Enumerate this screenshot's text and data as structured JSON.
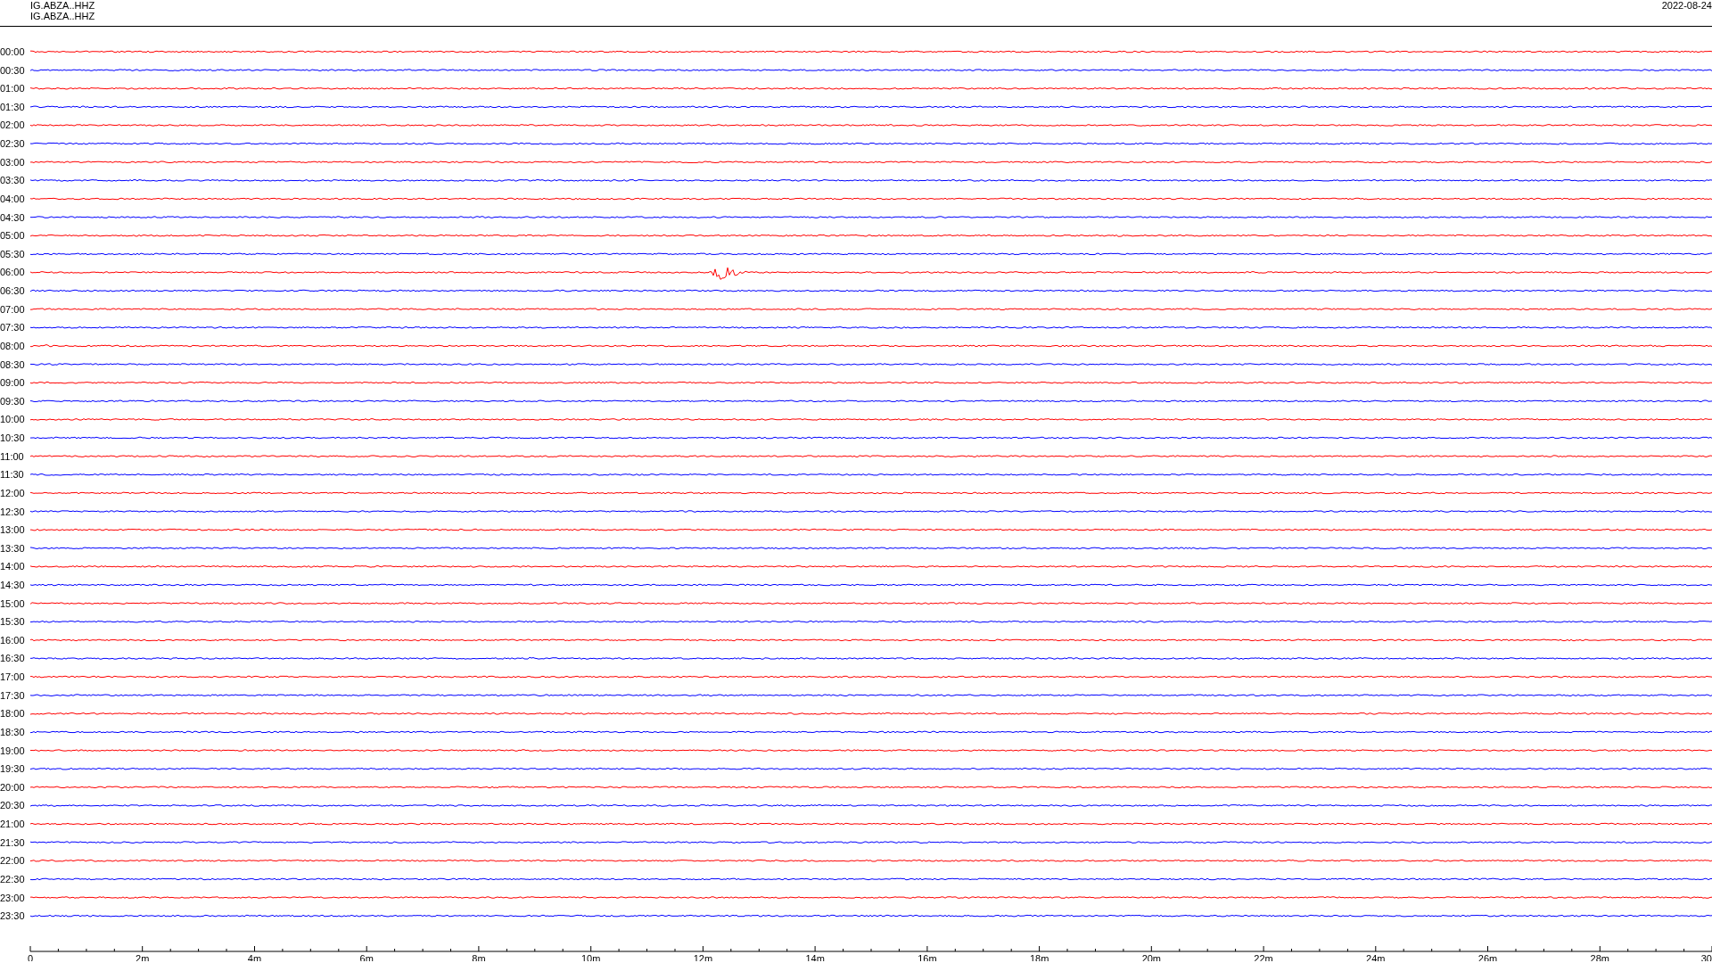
{
  "header": {
    "station_lines": [
      "IG.ABZA..HHZ",
      "IG.ABZA..HHZ"
    ],
    "date": "2022-08-24"
  },
  "rows": [
    {
      "label": "00:00",
      "color": "#ff0000"
    },
    {
      "label": "00:30",
      "color": "#0000ff"
    },
    {
      "label": "01:00",
      "color": "#ff0000"
    },
    {
      "label": "01:30",
      "color": "#0000ff"
    },
    {
      "label": "02:00",
      "color": "#ff0000"
    },
    {
      "label": "02:30",
      "color": "#0000ff"
    },
    {
      "label": "03:00",
      "color": "#ff0000"
    },
    {
      "label": "03:30",
      "color": "#0000ff"
    },
    {
      "label": "04:00",
      "color": "#ff0000"
    },
    {
      "label": "04:30",
      "color": "#0000ff"
    },
    {
      "label": "05:00",
      "color": "#ff0000"
    },
    {
      "label": "05:30",
      "color": "#0000ff"
    },
    {
      "label": "06:00",
      "color": "#ff0000"
    },
    {
      "label": "06:30",
      "color": "#0000ff"
    },
    {
      "label": "07:00",
      "color": "#ff0000"
    },
    {
      "label": "07:30",
      "color": "#0000ff"
    },
    {
      "label": "08:00",
      "color": "#ff0000"
    },
    {
      "label": "08:30",
      "color": "#0000ff"
    },
    {
      "label": "09:00",
      "color": "#ff0000"
    },
    {
      "label": "09:30",
      "color": "#0000ff"
    },
    {
      "label": "10:00",
      "color": "#ff0000"
    },
    {
      "label": "10:30",
      "color": "#0000ff"
    },
    {
      "label": "11:00",
      "color": "#ff0000"
    },
    {
      "label": "11:30",
      "color": "#0000ff"
    },
    {
      "label": "12:00",
      "color": "#ff0000"
    },
    {
      "label": "12:30",
      "color": "#0000ff"
    },
    {
      "label": "13:00",
      "color": "#ff0000"
    },
    {
      "label": "13:30",
      "color": "#0000ff"
    },
    {
      "label": "14:00",
      "color": "#ff0000"
    },
    {
      "label": "14:30",
      "color": "#0000ff"
    },
    {
      "label": "15:00",
      "color": "#ff0000"
    },
    {
      "label": "15:30",
      "color": "#0000ff"
    },
    {
      "label": "16:00",
      "color": "#ff0000"
    },
    {
      "label": "16:30",
      "color": "#0000ff"
    },
    {
      "label": "17:00",
      "color": "#ff0000"
    },
    {
      "label": "17:30",
      "color": "#0000ff"
    },
    {
      "label": "18:00",
      "color": "#ff0000"
    },
    {
      "label": "18:30",
      "color": "#0000ff"
    },
    {
      "label": "19:00",
      "color": "#ff0000"
    },
    {
      "label": "19:30",
      "color": "#0000ff"
    },
    {
      "label": "20:00",
      "color": "#ff0000"
    },
    {
      "label": "20:30",
      "color": "#0000ff"
    },
    {
      "label": "21:00",
      "color": "#ff0000"
    },
    {
      "label": "21:30",
      "color": "#0000ff"
    },
    {
      "label": "22:00",
      "color": "#ff0000"
    },
    {
      "label": "22:30",
      "color": "#0000ff"
    },
    {
      "label": "23:00",
      "color": "#ff0000"
    },
    {
      "label": "23:30",
      "color": "#0000ff"
    }
  ],
  "x_axis": {
    "tick_labels": [
      "0",
      "2m",
      "4m",
      "6m",
      "8m",
      "10m",
      "12m",
      "14m",
      "16m",
      "18m",
      "20m",
      "22m",
      "24m",
      "26m",
      "28m",
      "30"
    ]
  }
}
